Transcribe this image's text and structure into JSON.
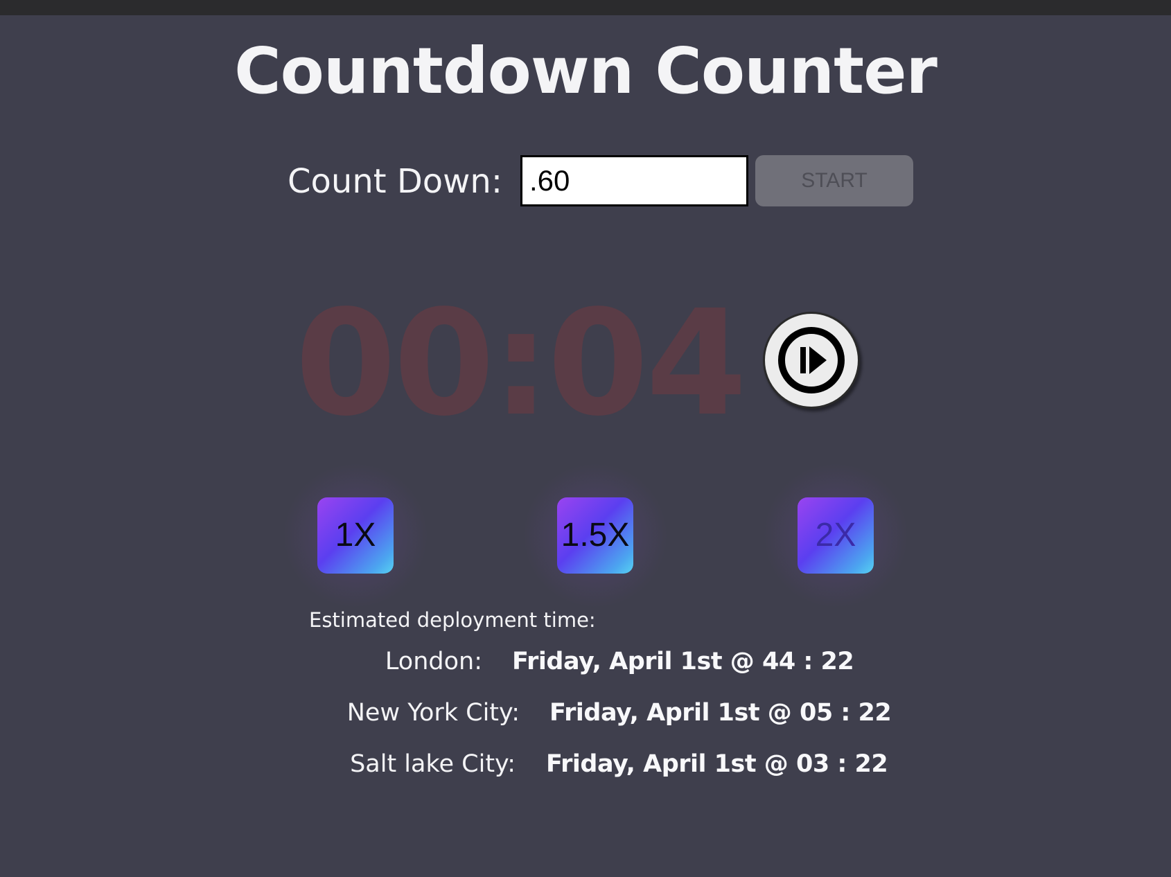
{
  "page": {
    "title": "Countdown Counter"
  },
  "countdown": {
    "label": "Count Down:",
    "input_value": ".60",
    "start_label": "START"
  },
  "timer": {
    "display": "00:04",
    "play_icon": "play-pause-icon"
  },
  "speeds": [
    {
      "label": "1X"
    },
    {
      "label": "1.5X"
    },
    {
      "label": "2X"
    }
  ],
  "deployment": {
    "label": "Estimated deployment time:",
    "cities": [
      {
        "name": "London:",
        "time": "Friday, April 1st @ 44 : 22"
      },
      {
        "name": "New York City:",
        "time": "Friday, April 1st @ 05 : 22"
      },
      {
        "name": "Salt lake City:",
        "time": "Friday, April 1st @ 03 : 22"
      }
    ]
  },
  "colors": {
    "background": "#3f3f4d",
    "timer_text": "#5a3c46",
    "speed_gradient_start": "#9a44f0",
    "speed_gradient_end": "#57d3f2",
    "start_button": "#707079"
  }
}
